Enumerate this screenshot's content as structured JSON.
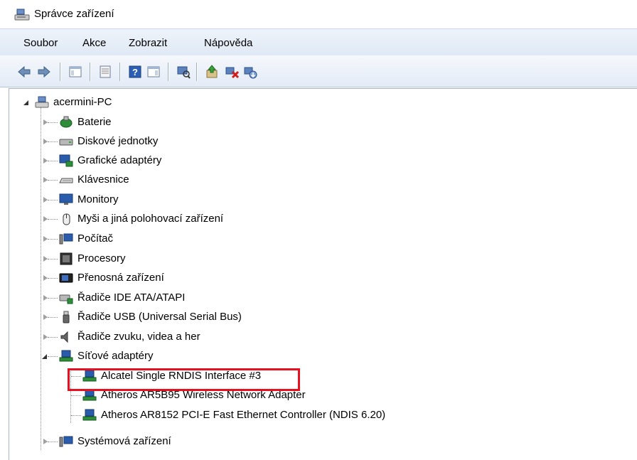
{
  "window": {
    "title": "Správce zařízení",
    "icon": "device-manager-icon"
  },
  "menu": [
    "Soubor",
    "Akce",
    "Zobrazit",
    "Nápověda"
  ],
  "toolbar": [
    "back-arrow-icon",
    "forward-arrow-icon",
    "show-hide-console-tree-icon",
    "properties-icon",
    "help-icon",
    "action-pane-icon",
    "scan-hardware-icon",
    "update-driver-icon",
    "disable-device-icon",
    "uninstall-device-icon"
  ],
  "tree": {
    "root": "acermini-PC",
    "categories": [
      {
        "label": "Baterie",
        "icon": "battery-icon"
      },
      {
        "label": "Diskové jednotky",
        "icon": "disk-drive-icon"
      },
      {
        "label": "Grafické adaptéry",
        "icon": "display-adapter-icon"
      },
      {
        "label": "Klávesnice",
        "icon": "keyboard-icon"
      },
      {
        "label": "Monitory",
        "icon": "monitor-icon"
      },
      {
        "label": "Myši a jiná polohovací zařízení",
        "icon": "mouse-icon"
      },
      {
        "label": "Počítač",
        "icon": "computer-icon"
      },
      {
        "label": "Procesory",
        "icon": "processor-icon"
      },
      {
        "label": "Přenosná zařízení",
        "icon": "portable-device-icon"
      },
      {
        "label": "Řadiče IDE ATA/ATAPI",
        "icon": "ide-controller-icon"
      },
      {
        "label": "Řadiče USB (Universal Serial Bus)",
        "icon": "usb-controller-icon"
      },
      {
        "label": "Řadiče zvuku, videa a her",
        "icon": "sound-icon"
      },
      {
        "label": "Síťové adaptéry",
        "icon": "network-adapter-icon",
        "expanded": true,
        "children": [
          "Alcatel Single RNDIS Interface #3",
          "Atheros AR5B95 Wireless Network Adapter",
          "Atheros AR8152 PCI-E Fast Ethernet Controller (NDIS 6.20)"
        ]
      },
      {
        "label": "Systémová zařízení",
        "icon": "system-devices-icon"
      }
    ]
  },
  "highlight_color": "#e8101f"
}
